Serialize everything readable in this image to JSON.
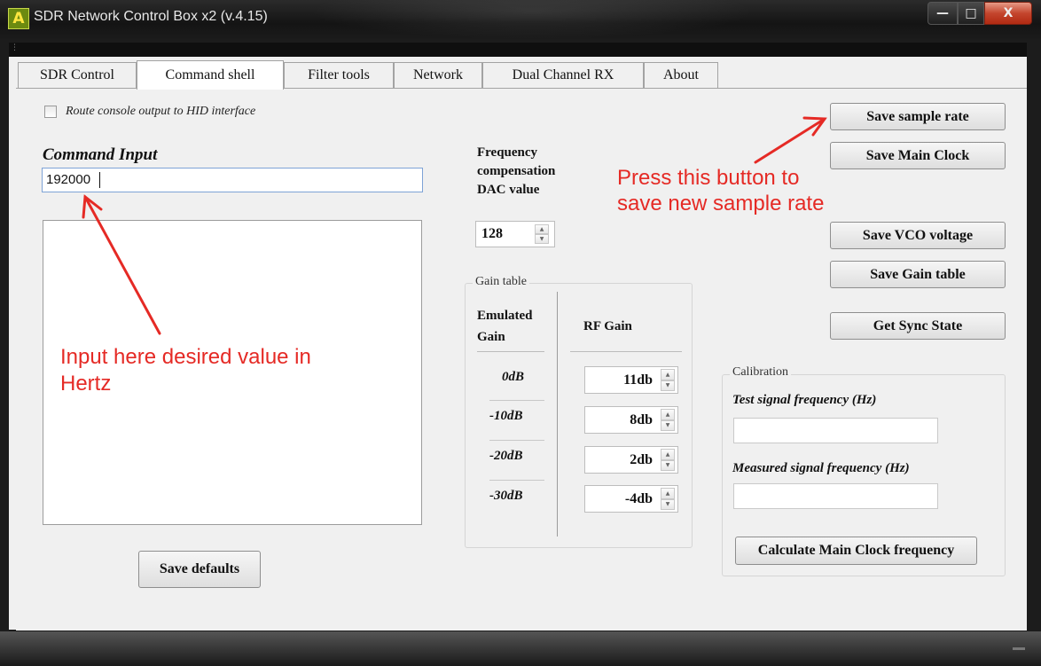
{
  "window": {
    "title": "SDR Network Control Box x2 (v.4.15)",
    "app_icon_glyph": "A",
    "minimize_glyph": "—",
    "maximize_glyph": "□",
    "close_glyph": "X"
  },
  "tabs": [
    {
      "label": "SDR Control",
      "active": false
    },
    {
      "label": "Command shell",
      "active": true
    },
    {
      "label": "Filter tools",
      "active": false
    },
    {
      "label": "Network",
      "active": false
    },
    {
      "label": "Dual Channel RX",
      "active": false
    },
    {
      "label": "About",
      "active": false
    }
  ],
  "command_shell": {
    "route_checkbox_label": "Route console output to HID interface",
    "route_checkbox_checked": false,
    "command_input_label": "Command Input",
    "command_input_value": "192000",
    "save_defaults_label": "Save defaults"
  },
  "freq_comp": {
    "label_line1": "Frequency",
    "label_line2": "compensation",
    "label_line3": "DAC value",
    "value": "128"
  },
  "gain_table": {
    "legend": "Gain table",
    "emulated_header_line1": "Emulated",
    "emulated_header_line2": "Gain",
    "rf_header": "RF Gain",
    "rows": [
      {
        "emulated": "0dB",
        "rf": "11db"
      },
      {
        "emulated": "-10dB",
        "rf": "8db"
      },
      {
        "emulated": "-20dB",
        "rf": "2db"
      },
      {
        "emulated": "-30dB",
        "rf": "-4db"
      }
    ]
  },
  "buttons": {
    "save_sample_rate": "Save sample rate",
    "save_main_clock": "Save Main Clock",
    "save_vco_voltage": "Save VCO voltage",
    "save_gain_table": "Save Gain table",
    "get_sync_state": "Get Sync State"
  },
  "calibration": {
    "legend": "Calibration",
    "test_label": "Test signal frequency (Hz)",
    "test_value": "",
    "measured_label": "Measured signal frequency (Hz)",
    "measured_value": "",
    "calculate_label": "Calculate Main Clock frequency"
  },
  "annotations": {
    "press_line1": "Press this button to",
    "press_line2": "save new sample rate",
    "input_line1": "Input here desired value in",
    "input_line2": "Hertz",
    "color": "#e52a25"
  }
}
